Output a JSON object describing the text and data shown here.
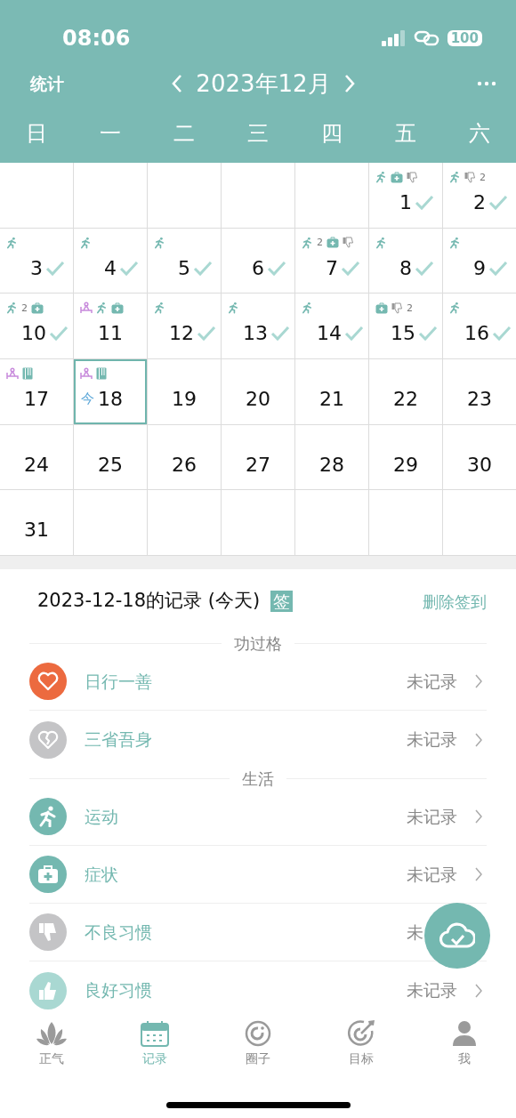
{
  "status_bar": {
    "time": "08:06",
    "battery": "100"
  },
  "header": {
    "left_link": "统计",
    "month": "2023年12月",
    "weekdays": [
      "日",
      "一",
      "二",
      "三",
      "四",
      "五",
      "六"
    ]
  },
  "calendar": {
    "weeks": [
      [
        {
          "kind": "blank"
        },
        {
          "kind": "blank"
        },
        {
          "kind": "blank"
        },
        {
          "kind": "blank"
        },
        {
          "kind": "blank"
        },
        {
          "kind": "day",
          "day": "1",
          "checked": true,
          "selected": false,
          "marks": [
            {
              "kind": "run"
            },
            {
              "kind": "medkit"
            },
            {
              "kind": "thumbdown"
            }
          ]
        },
        {
          "kind": "day",
          "day": "2",
          "checked": true,
          "selected": false,
          "marks": [
            {
              "kind": "run"
            },
            {
              "kind": "thumbdown",
              "count": "2"
            }
          ]
        }
      ],
      [
        {
          "kind": "day",
          "day": "3",
          "checked": true,
          "selected": false,
          "marks": [
            {
              "kind": "run"
            }
          ]
        },
        {
          "kind": "day",
          "day": "4",
          "checked": true,
          "selected": false,
          "marks": [
            {
              "kind": "run"
            }
          ]
        },
        {
          "kind": "day",
          "day": "5",
          "checked": true,
          "selected": false,
          "marks": [
            {
              "kind": "run"
            }
          ]
        },
        {
          "kind": "day",
          "day": "6",
          "checked": true,
          "selected": false
        },
        {
          "kind": "day",
          "day": "7",
          "checked": true,
          "selected": false,
          "marks": [
            {
              "kind": "run",
              "count": "2"
            },
            {
              "kind": "medkit"
            },
            {
              "kind": "thumbdown"
            }
          ]
        },
        {
          "kind": "day",
          "day": "8",
          "checked": true,
          "selected": false,
          "marks": [
            {
              "kind": "run"
            }
          ]
        },
        {
          "kind": "day",
          "day": "9",
          "checked": true,
          "selected": false,
          "marks": [
            {
              "kind": "run"
            }
          ]
        }
      ],
      [
        {
          "kind": "day",
          "day": "10",
          "checked": true,
          "selected": false,
          "marks": [
            {
              "kind": "run",
              "count": "2"
            },
            {
              "kind": "medkit"
            }
          ]
        },
        {
          "kind": "day",
          "day": "11",
          "checked": false,
          "selected": false,
          "marks": [
            {
              "kind": "sitting"
            },
            {
              "kind": "run"
            },
            {
              "kind": "medkit"
            }
          ]
        },
        {
          "kind": "day",
          "day": "12",
          "checked": true,
          "selected": false,
          "marks": [
            {
              "kind": "run"
            }
          ]
        },
        {
          "kind": "day",
          "day": "13",
          "checked": true,
          "selected": false,
          "marks": [
            {
              "kind": "run"
            }
          ]
        },
        {
          "kind": "day",
          "day": "14",
          "checked": true,
          "selected": false,
          "marks": [
            {
              "kind": "run"
            }
          ]
        },
        {
          "kind": "day",
          "day": "15",
          "checked": true,
          "selected": false,
          "marks": [
            {
              "kind": "medkit"
            },
            {
              "kind": "thumbdown",
              "count": "2"
            }
          ]
        },
        {
          "kind": "day",
          "day": "16",
          "checked": true,
          "selected": false,
          "marks": [
            {
              "kind": "run"
            }
          ]
        }
      ],
      [
        {
          "kind": "day",
          "day": "17",
          "checked": false,
          "selected": false,
          "marks": [
            {
              "kind": "sitting"
            },
            {
              "kind": "book"
            }
          ]
        },
        {
          "kind": "day",
          "day": "18",
          "checked": false,
          "selected": true,
          "today_label": "今",
          "marks": [
            {
              "kind": "sitting"
            },
            {
              "kind": "book"
            }
          ]
        },
        {
          "kind": "day",
          "day": "19",
          "checked": false,
          "selected": false
        },
        {
          "kind": "day",
          "day": "20",
          "checked": false,
          "selected": false
        },
        {
          "kind": "day",
          "day": "21",
          "checked": false,
          "selected": false
        },
        {
          "kind": "day",
          "day": "22",
          "checked": false,
          "selected": false
        },
        {
          "kind": "day",
          "day": "23",
          "checked": false,
          "selected": false
        }
      ],
      [
        {
          "kind": "day",
          "day": "24",
          "checked": false,
          "selected": false
        },
        {
          "kind": "day",
          "day": "25",
          "checked": false,
          "selected": false
        },
        {
          "kind": "day",
          "day": "26",
          "checked": false,
          "selected": false
        },
        {
          "kind": "day",
          "day": "27",
          "checked": false,
          "selected": false
        },
        {
          "kind": "day",
          "day": "28",
          "checked": false,
          "selected": false
        },
        {
          "kind": "day",
          "day": "29",
          "checked": false,
          "selected": false
        },
        {
          "kind": "day",
          "day": "30",
          "checked": false,
          "selected": false
        }
      ],
      [
        {
          "kind": "day",
          "day": "31",
          "checked": false,
          "selected": false
        },
        {
          "kind": "blank"
        },
        {
          "kind": "blank"
        },
        {
          "kind": "blank"
        },
        {
          "kind": "blank"
        },
        {
          "kind": "blank"
        },
        {
          "kind": "blank"
        }
      ]
    ]
  },
  "record": {
    "title": "2023-12-18的记录 (今天)",
    "badge": "签",
    "action": "删除签到",
    "sections": [
      {
        "title": "功过格",
        "items": [
          {
            "label": "日行一善",
            "status": "未记录",
            "kind": "heart",
            "color": "#ec6a3f",
            "chevron": true
          },
          {
            "label": "三省吾身",
            "status": "未记录",
            "kind": "brokenheart",
            "color": "#c4c4c6",
            "chevron": true
          }
        ]
      },
      {
        "title": "生活",
        "items": [
          {
            "label": "运动",
            "status": "未记录",
            "kind": "run",
            "color": "#74b8b0",
            "chevron": true
          },
          {
            "label": "症状",
            "status": "未记录",
            "kind": "medkit",
            "color": "#74b8b0",
            "chevron": true
          },
          {
            "label": "不良习惯",
            "status": "未",
            "kind": "thumbdown",
            "color": "#c4c4c6",
            "chevron": false
          },
          {
            "label": "良好习惯",
            "status": "未记录",
            "kind": "thumbup",
            "color": "#a9d8d2",
            "chevron": true
          }
        ]
      }
    ]
  },
  "tab_bar": [
    {
      "label": "正气",
      "kind": "lotus",
      "selected": false
    },
    {
      "label": "记录",
      "kind": "calendar",
      "selected": true
    },
    {
      "label": "圈子",
      "kind": "ring",
      "selected": false
    },
    {
      "label": "目标",
      "kind": "target",
      "selected": false
    },
    {
      "label": "我",
      "kind": "person",
      "selected": false
    }
  ]
}
